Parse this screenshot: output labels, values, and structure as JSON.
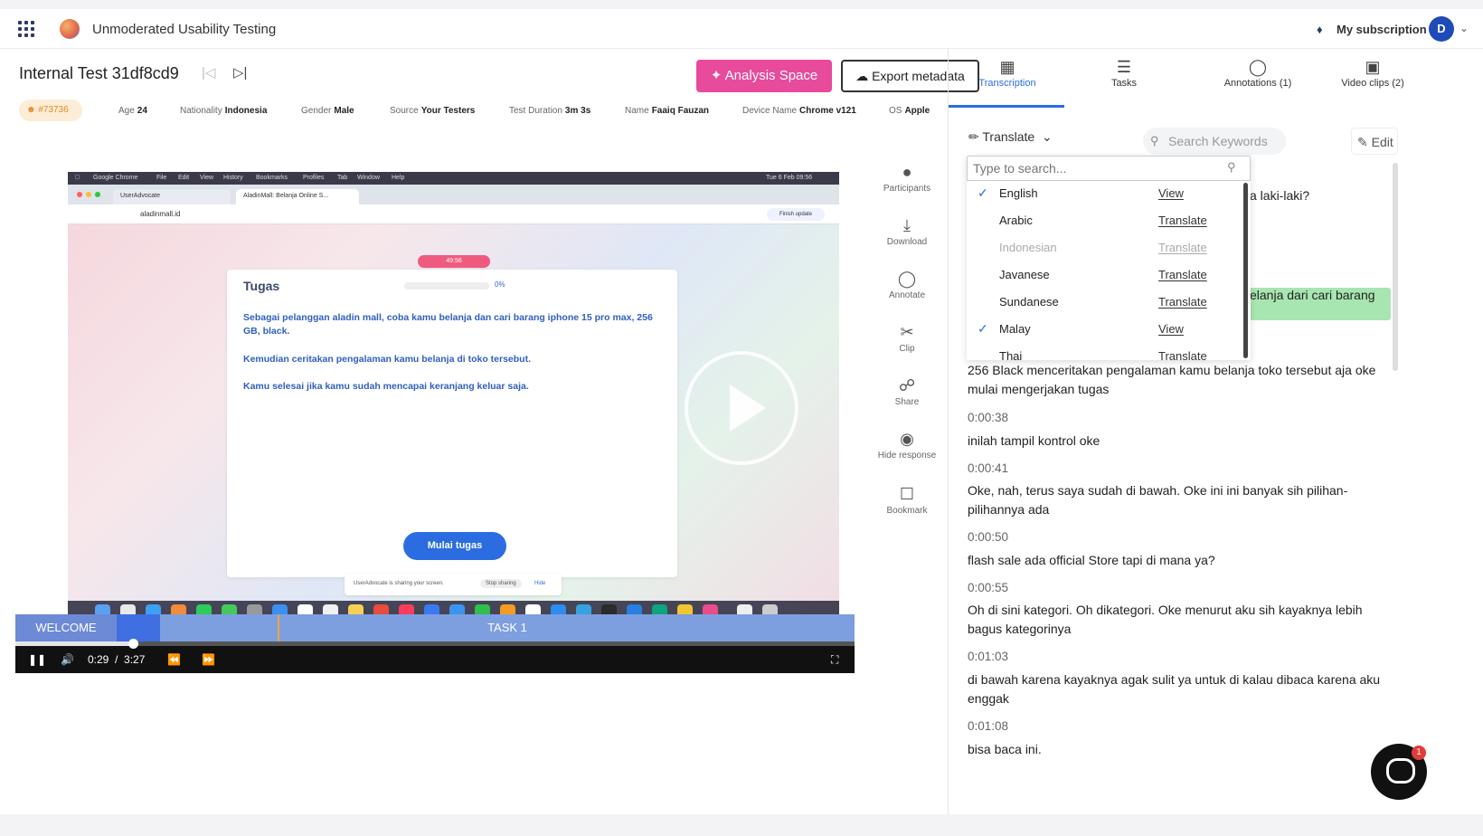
{
  "header": {
    "app_title": "Unmoderated Usability Testing",
    "subscription_label": "My subscription",
    "avatar_initial": "D"
  },
  "test": {
    "title": "Internal Test 31df8cd9",
    "analysis_button": "Analysis Space",
    "export_button": "Export metadata"
  },
  "meta": {
    "id_badge": "#73736",
    "items": [
      {
        "label": "Age",
        "value": "24"
      },
      {
        "label": "Nationality",
        "value": "Indonesia"
      },
      {
        "label": "Gender",
        "value": "Male"
      },
      {
        "label": "Source",
        "value": "Your Testers"
      },
      {
        "label": "Test Duration",
        "value": "3m 3s"
      },
      {
        "label": "Name",
        "value": "Faaiq Fauzan"
      },
      {
        "label": "Device Name",
        "value": "Chrome v121"
      },
      {
        "label": "OS",
        "value": "Apple"
      }
    ]
  },
  "video": {
    "mac_menu": [
      "Google Chrome",
      "File",
      "Edit",
      "View",
      "History",
      "Bookmarks",
      "Profiles",
      "Tab",
      "Window",
      "Help"
    ],
    "mac_clock": "Tue 6 Feb 09:56",
    "tab1": "UserAdvocate",
    "tab2": "AladinMall: Belanja Online S...",
    "url": "aladinmall.id",
    "finish_update": "Finish update",
    "rec_pill": "49:56",
    "task_title": "Tugas",
    "task_pct": "0%",
    "task_p1": "Sebagai pelanggan aladin mall, coba kamu belanja dan cari barang iphone 15 pro max, 256 GB, black.",
    "task_p2": "Kemudian ceritakan pengalaman kamu belanja di toko tersebut.",
    "task_p3": "Kamu selesai jika kamu sudah mencapai keranjang keluar saja.",
    "start_button": "Mulai tugas",
    "share_text": "UserAdvocate is sharing your screen.",
    "stop_sharing": "Stop sharing",
    "hide": "Hide"
  },
  "timeline": {
    "welcome": "WELCOME",
    "task": "TASK 1"
  },
  "player": {
    "current_time": "0:29",
    "separator": "/",
    "duration": "3:27",
    "progress_fraction": 0.14
  },
  "toolbar": [
    {
      "label": "Participants",
      "icon": "user-icon"
    },
    {
      "label": "Download",
      "icon": "download-icon"
    },
    {
      "label": "Annotate",
      "icon": "annotate-icon"
    },
    {
      "label": "Clip",
      "icon": "scissors-icon"
    },
    {
      "label": "Share",
      "icon": "share-icon"
    },
    {
      "label": "Hide response",
      "icon": "eye-icon"
    },
    {
      "label": "Bookmark",
      "icon": "bookmark-icon"
    }
  ],
  "right_tabs": [
    {
      "label": "Transcription",
      "active": true
    },
    {
      "label": "Tasks"
    },
    {
      "label": "Annotations (1)"
    },
    {
      "label": "Video clips (2)"
    }
  ],
  "panel": {
    "translate_label": "Translate",
    "search_placeholder": "Search Keywords",
    "edit_label": "Edit"
  },
  "language_dropdown": {
    "search_placeholder": "Type to search...",
    "options": [
      {
        "lang": "English",
        "action": "View",
        "checked": true
      },
      {
        "lang": "Arabic",
        "action": "Translate"
      },
      {
        "lang": "Indonesian",
        "action": "Translate",
        "disabled": true
      },
      {
        "lang": "Javanese",
        "action": "Translate"
      },
      {
        "lang": "Sundanese",
        "action": "Translate"
      },
      {
        "lang": "Malay",
        "action": "View",
        "checked": true
      },
      {
        "lang": "Thai",
        "action": "Translate"
      }
    ]
  },
  "transcript": {
    "partial_1": "a laki-laki?",
    "partial_2": "elanja dari cari barang",
    "entries": [
      {
        "time": "",
        "text": "256 Black menceritakan pengalaman kamu belanja toko tersebut aja oke mulai mengerjakan tugas"
      },
      {
        "time": "0:00:38",
        "text": "inilah tampil kontrol oke"
      },
      {
        "time": "0:00:41",
        "text": "Oke, nah, terus saya sudah di bawah. Oke ini ini banyak sih pilihan-pilihannya ada"
      },
      {
        "time": "0:00:50",
        "text": "flash sale ada official Store tapi di mana ya?"
      },
      {
        "time": "0:00:55",
        "text": "Oh di sini kategori. Oh dikategori. Oke menurut aku sih kayaknya lebih bagus kategorinya"
      },
      {
        "time": "0:01:03",
        "text": "di bawah karena kayaknya agak sulit ya untuk di kalau dibaca karena aku enggak"
      },
      {
        "time": "0:01:08",
        "text": "bisa baca ini."
      }
    ]
  },
  "chat": {
    "badge": "1"
  },
  "colors": {
    "accent": "#2b6de0",
    "analysis": "#e84a9c",
    "highlight": "#a8e6b1"
  }
}
